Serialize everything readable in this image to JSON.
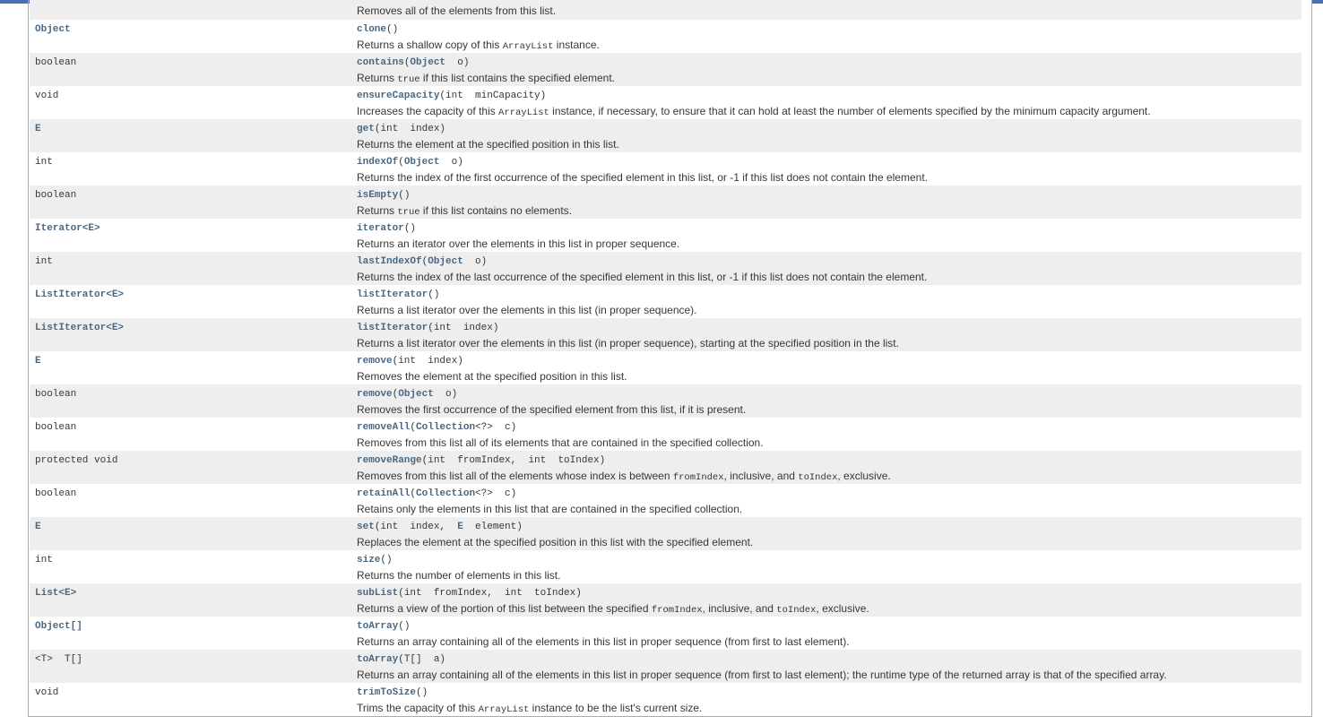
{
  "top_partial": {
    "desc": "Removes all of the elements from this list."
  },
  "rows": [
    {
      "type": "Object",
      "type_link": true,
      "name": "clone",
      "params": "()",
      "desc_parts": [
        "Returns a shallow copy of this ",
        "ArrayList",
        " instance."
      ]
    },
    {
      "type": "boolean",
      "type_link": false,
      "name": "contains",
      "params_html": [
        "(",
        "Object",
        "  o)"
      ],
      "desc_parts": [
        "Returns ",
        "true",
        " if this list contains the specified element."
      ]
    },
    {
      "type": "void",
      "type_link": false,
      "name": "ensureCapacity",
      "params": "(int  minCapacity)",
      "desc_parts": [
        "Increases the capacity of this ",
        "ArrayList",
        " instance, if necessary, to ensure that it can hold at least the number of elements specified by the minimum capacity argument."
      ]
    },
    {
      "type": "E",
      "type_link": true,
      "name": "get",
      "params": "(int  index)",
      "desc_parts": [
        "Returns the element at the specified position in this list."
      ]
    },
    {
      "type": "int",
      "type_link": false,
      "name": "indexOf",
      "params_html": [
        "(",
        "Object",
        "  o)"
      ],
      "desc_parts": [
        "Returns the index of the first occurrence of the specified element in this list, or -1 if this list does not contain the element."
      ]
    },
    {
      "type": "boolean",
      "type_link": false,
      "name": "isEmpty",
      "params": "()",
      "desc_parts": [
        "Returns ",
        "true",
        " if this list contains no elements."
      ]
    },
    {
      "type": "Iterator<E>",
      "type_link": true,
      "name": "iterator",
      "params": "()",
      "desc_parts": [
        "Returns an iterator over the elements in this list in proper sequence."
      ]
    },
    {
      "type": "int",
      "type_link": false,
      "name": "lastIndexOf",
      "params_html": [
        "(",
        "Object",
        "  o)"
      ],
      "desc_parts": [
        "Returns the index of the last occurrence of the specified element in this list, or -1 if this list does not contain the element."
      ]
    },
    {
      "type": "ListIterator<E>",
      "type_link": true,
      "name": "listIterator",
      "params": "()",
      "desc_parts": [
        "Returns a list iterator over the elements in this list (in proper sequence)."
      ]
    },
    {
      "type": "ListIterator<E>",
      "type_link": true,
      "name": "listIterator",
      "params": "(int  index)",
      "desc_parts": [
        "Returns a list iterator over the elements in this list (in proper sequence), starting at the specified position in the list."
      ]
    },
    {
      "type": "E",
      "type_link": true,
      "name": "remove",
      "params": "(int  index)",
      "desc_parts": [
        "Removes the element at the specified position in this list."
      ]
    },
    {
      "type": "boolean",
      "type_link": false,
      "name": "remove",
      "params_html": [
        "(",
        "Object",
        "  o)"
      ],
      "desc_parts": [
        "Removes the first occurrence of the specified element from this list, if it is present."
      ]
    },
    {
      "type": "boolean",
      "type_link": false,
      "name": "removeAll",
      "params_html": [
        "(",
        "Collection",
        "<?>  c)"
      ],
      "desc_parts": [
        "Removes from this list all of its elements that are contained in the specified collection."
      ]
    },
    {
      "type": "protected void",
      "type_link": false,
      "name": "removeRange",
      "params": "(int  fromIndex,  int  toIndex)",
      "desc_parts": [
        "Removes from this list all of the elements whose index is between ",
        "fromIndex",
        ", inclusive, and ",
        "toIndex",
        ", exclusive."
      ]
    },
    {
      "type": "boolean",
      "type_link": false,
      "name": "retainAll",
      "params_html": [
        "(",
        "Collection",
        "<?>  c)"
      ],
      "desc_parts": [
        "Retains only the elements in this list that are contained in the specified collection."
      ]
    },
    {
      "type": "E",
      "type_link": true,
      "name": "set",
      "params_html": [
        "(int  index,  ",
        "E",
        "  element)"
      ],
      "desc_parts": [
        "Replaces the element at the specified position in this list with the specified element."
      ]
    },
    {
      "type": "int",
      "type_link": false,
      "name": "size",
      "params": "()",
      "desc_parts": [
        "Returns the number of elements in this list."
      ]
    },
    {
      "type": "List<E>",
      "type_link": true,
      "name": "subList",
      "params": "(int  fromIndex,  int  toIndex)",
      "desc_parts": [
        "Returns a view of the portion of this list between the specified ",
        "fromIndex",
        ", inclusive, and ",
        "toIndex",
        ", exclusive."
      ]
    },
    {
      "type": "Object[]",
      "type_link": true,
      "name": "toArray",
      "params": "()",
      "desc_parts": [
        "Returns an array containing all of the elements in this list in proper sequence (from first to last element)."
      ]
    },
    {
      "type": "<T>  T[]",
      "type_link": false,
      "name": "toArray",
      "params": "(T[]  a)",
      "desc_parts": [
        "Returns an array containing all of the elements in this list in proper sequence (from first to last element); the runtime type of the returned array is that of the specified array."
      ]
    },
    {
      "type": "void",
      "type_link": false,
      "name": "trimToSize",
      "params": "()",
      "desc_parts": [
        "Trims the capacity of this ",
        "ArrayList",
        " instance to be the list's current size."
      ]
    }
  ],
  "colors": {
    "link": "#4a6782",
    "text": "#353833",
    "alt_row": "#eeeeee",
    "border": "#9eadc0",
    "topbar": "#4a6fb0"
  }
}
